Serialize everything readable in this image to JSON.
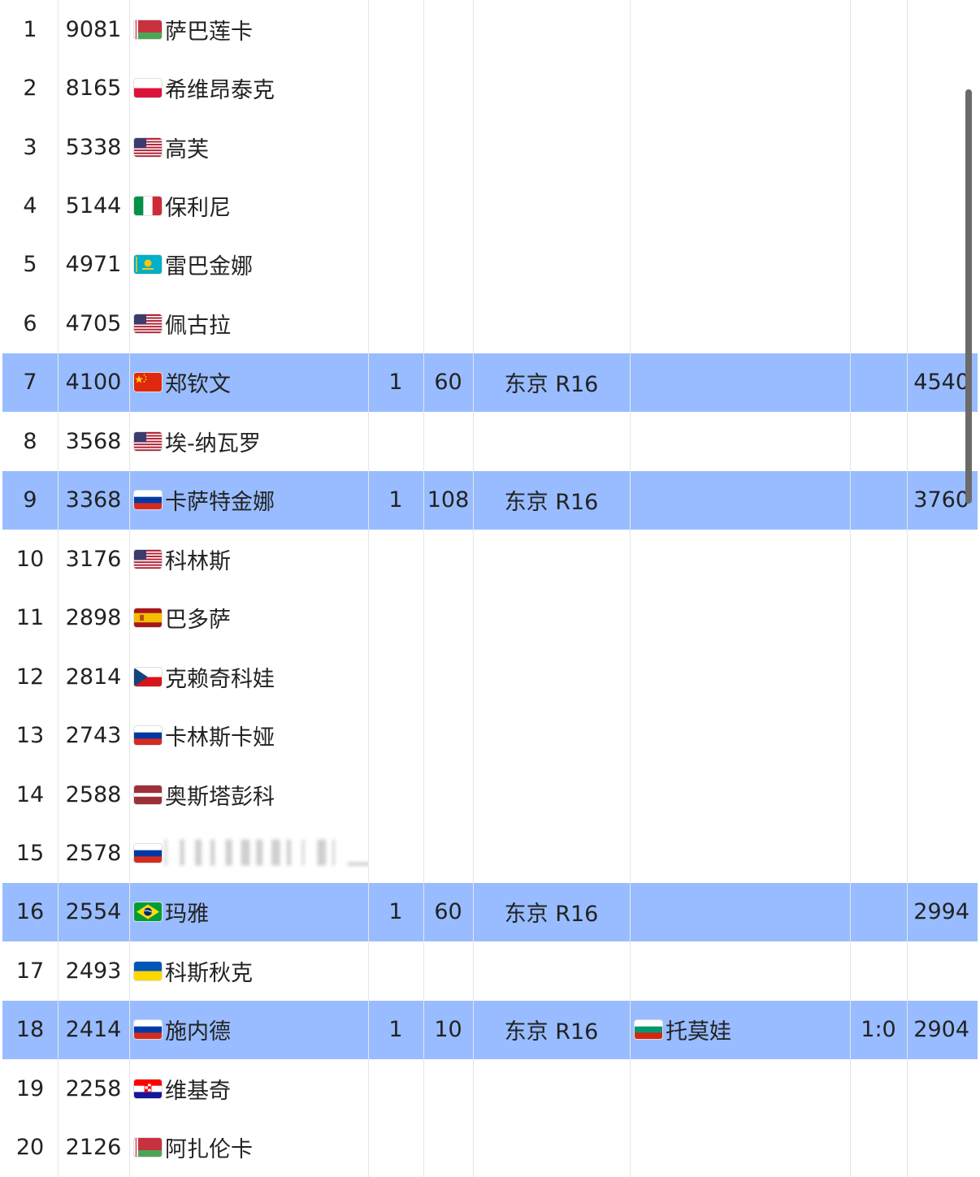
{
  "colors": {
    "highlight_row": "#98bcff",
    "background": "#ffffff",
    "text": "#222222",
    "gridline": "#e6e6e6"
  },
  "rows": [
    {
      "rank": "1",
      "points": "9081",
      "flag": "belarus-flag",
      "name": "萨巴莲卡"
    },
    {
      "rank": "2",
      "points": "8165",
      "flag": "poland-flag",
      "name": "希维昂泰克"
    },
    {
      "rank": "3",
      "points": "5338",
      "flag": "usa-flag",
      "name": "高芙"
    },
    {
      "rank": "4",
      "points": "5144",
      "flag": "italy-flag",
      "name": "保利尼"
    },
    {
      "rank": "5",
      "points": "4971",
      "flag": "kazakhstan-flag",
      "name": "雷巴金娜"
    },
    {
      "rank": "6",
      "points": "4705",
      "flag": "usa-flag",
      "name": "佩古拉"
    },
    {
      "rank": "7",
      "points": "4100",
      "flag": "china-flag",
      "name": "郑钦文",
      "highlight": true,
      "tournaments": "1",
      "added": "60",
      "event": "东京 R16",
      "live_points": "4540"
    },
    {
      "rank": "8",
      "points": "3568",
      "flag": "usa-flag",
      "name": "埃-纳瓦罗"
    },
    {
      "rank": "9",
      "points": "3368",
      "flag": "russia-flag",
      "name": "卡萨特金娜",
      "highlight": true,
      "tournaments": "1",
      "added": "108",
      "event": "东京 R16",
      "live_points": "3760"
    },
    {
      "rank": "10",
      "points": "3176",
      "flag": "usa-flag",
      "name": "科林斯"
    },
    {
      "rank": "11",
      "points": "2898",
      "flag": "spain-flag",
      "name": "巴多萨"
    },
    {
      "rank": "12",
      "points": "2814",
      "flag": "czech-flag",
      "name": "克赖奇科娃"
    },
    {
      "rank": "13",
      "points": "2743",
      "flag": "russia-flag",
      "name": "卡林斯卡娅"
    },
    {
      "rank": "14",
      "points": "2588",
      "flag": "latvia-flag",
      "name": "奥斯塔彭科"
    },
    {
      "rank": "15",
      "points": "2578",
      "flag": "russia-flag",
      "name": "",
      "redacted": true
    },
    {
      "rank": "16",
      "points": "2554",
      "flag": "brazil-flag",
      "name": "玛雅",
      "highlight": true,
      "tournaments": "1",
      "added": "60",
      "event": "东京 R16",
      "live_points": "2994"
    },
    {
      "rank": "17",
      "points": "2493",
      "flag": "ukraine-flag",
      "name": "科斯秋克"
    },
    {
      "rank": "18",
      "points": "2414",
      "flag": "russia-flag",
      "name": "施内德",
      "highlight": true,
      "tournaments": "1",
      "added": "10",
      "event": "东京 R16",
      "opponent_flag": "bulgaria-flag",
      "opponent": "托莫娃",
      "score": "1:0",
      "live_points": "2904"
    },
    {
      "rank": "19",
      "points": "2258",
      "flag": "croatia-flag",
      "name": "维基奇"
    },
    {
      "rank": "20",
      "points": "2126",
      "flag": "belarus-flag",
      "name": "阿扎伦卡"
    }
  ]
}
